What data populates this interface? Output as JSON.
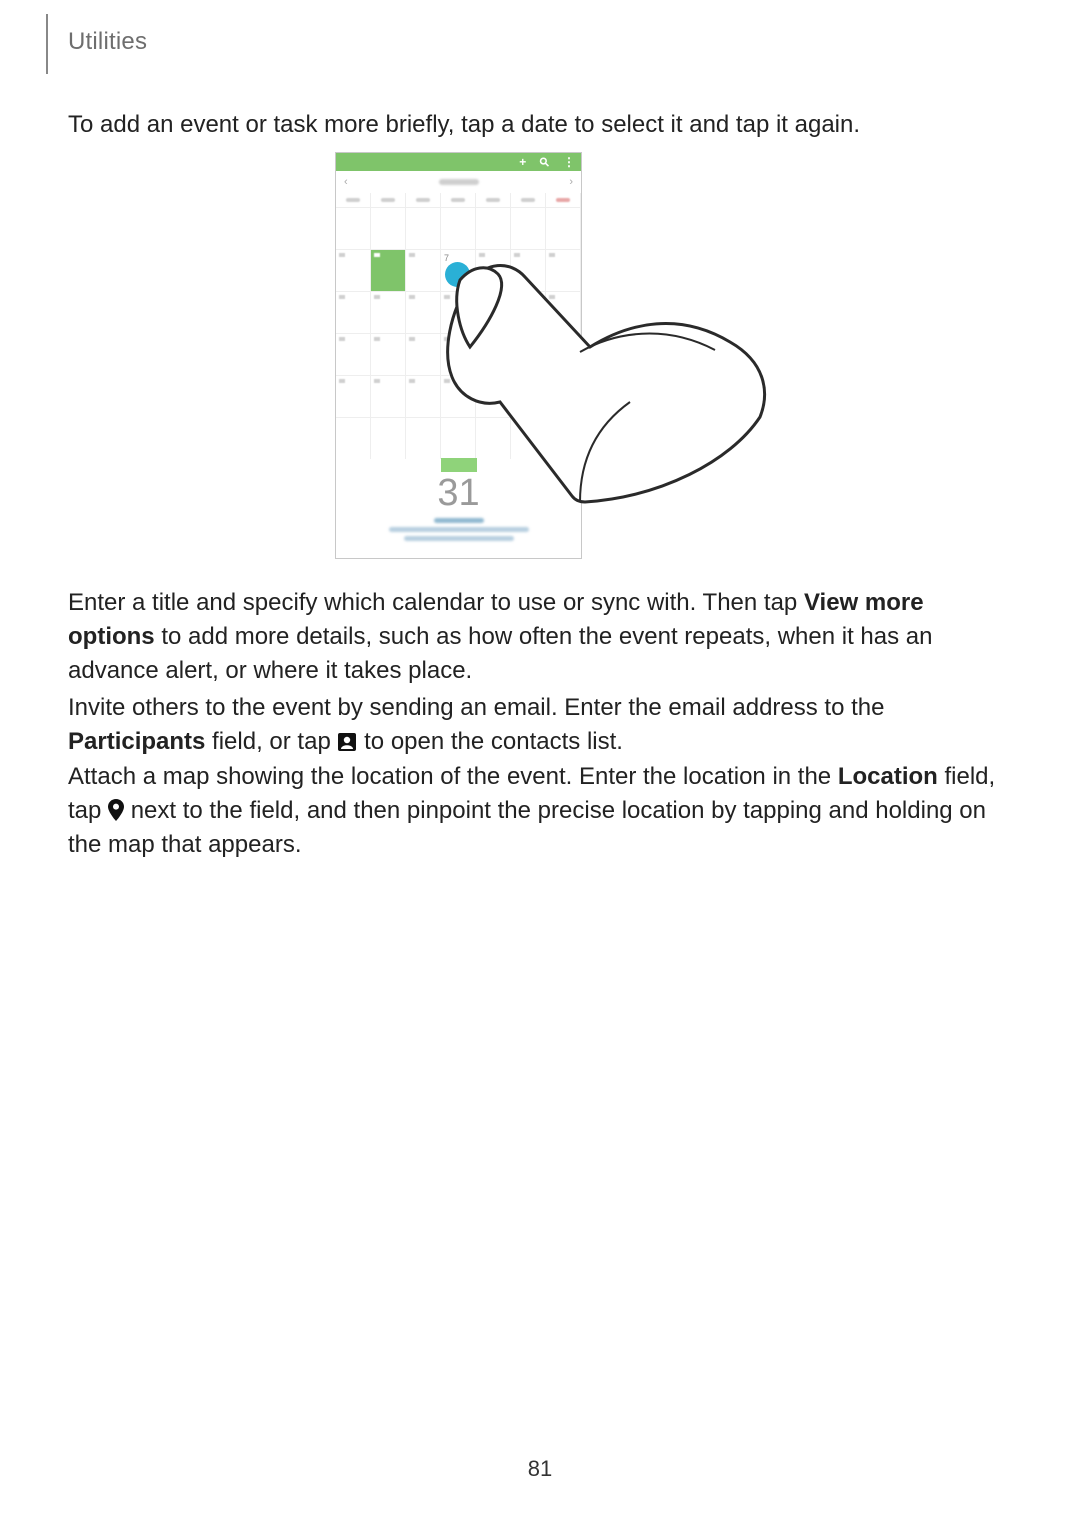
{
  "header": {
    "section": "Utilities"
  },
  "body": {
    "p1": "To add an event or task more briefly, tap a date to select it and tap it again.",
    "p2_a": "Enter a title and specify which calendar to use or sync with. Then tap ",
    "p2_bold": "View more options",
    "p2_b": " to add more details, such as how often the event repeats, when it has an advance alert, or where it takes place.",
    "p3_a": "Invite others to the event by sending an email. Enter the email address to the ",
    "p3_bold": "Participants",
    "p3_b": " field, or tap ",
    "p3_c": " to open the contacts list.",
    "p4_a": "Attach a map showing the location of the event. Enter the location in the ",
    "p4_bold": "Location",
    "p4_b": " field, tap ",
    "p4_c": " next to the field, and then pinpoint the precise location by tapping and holding on the map that appears."
  },
  "figure": {
    "selected_date_number": "7",
    "big_number": "31",
    "topbar_icons": {
      "plus": "+",
      "search": "⚲",
      "more": "⋮"
    }
  },
  "footer": {
    "page_number": "81"
  }
}
